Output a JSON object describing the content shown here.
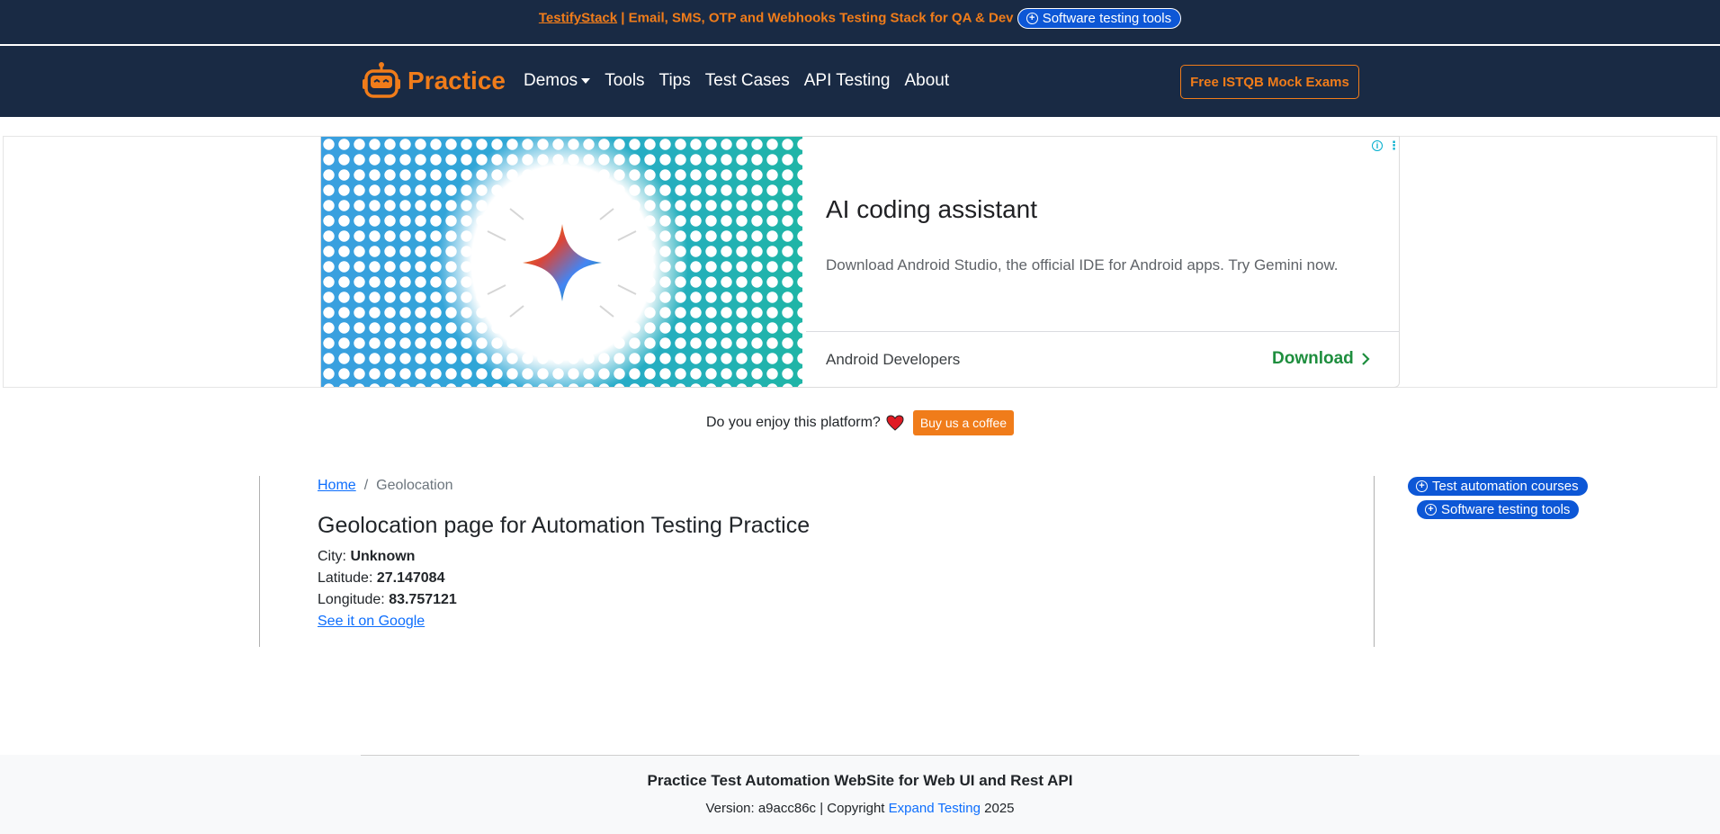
{
  "promo": {
    "brand": "TestifyStack",
    "text": " | Email, SMS, OTP and Webhooks Testing Stack for QA & Dev",
    "pill_label": "Software testing tools"
  },
  "navbar": {
    "logo_text": "Practice",
    "links": [
      "Demos",
      "Tools",
      "Tips",
      "Test Cases",
      "API Testing",
      "About"
    ],
    "cta": "Free ISTQB Mock Exams"
  },
  "ad": {
    "title": "AI coding assistant",
    "description": "Download Android Studio, the official IDE for Android apps. Try Gemini now.",
    "advertiser": "Android Developers",
    "cta": "Download",
    "info_icon": "info-icon",
    "colors": {
      "cta": "#1e8e3e",
      "pattern_left": "#3b9ede",
      "pattern_right": "#1fb3a8"
    }
  },
  "coffee": {
    "question": "Do you enjoy this platform?",
    "button": "Buy us a coffee"
  },
  "breadcrumb": {
    "home": "Home",
    "separator": "/",
    "current": "Geolocation"
  },
  "content": {
    "title": "Geolocation page for Automation Testing Practice",
    "city_label": "City:",
    "city_value": "Unknown",
    "lat_label": "Latitude:",
    "lat_value": "27.147084",
    "lon_label": "Longitude:",
    "lon_value": "83.757121",
    "google_link": "See it on Google"
  },
  "sidebar": {
    "pill1": "Test automation courses",
    "pill2": "Software testing tools"
  },
  "footer": {
    "title": "Practice Test Automation WebSite for Web UI and Rest API",
    "version_text": "Version: a9acc86c | Copyright ",
    "company": "Expand Testing",
    "year": " 2025"
  },
  "colors": {
    "navy": "#192a44",
    "orange": "#f07c1a",
    "blue": "#0d57d6",
    "link": "#0d6efd"
  }
}
